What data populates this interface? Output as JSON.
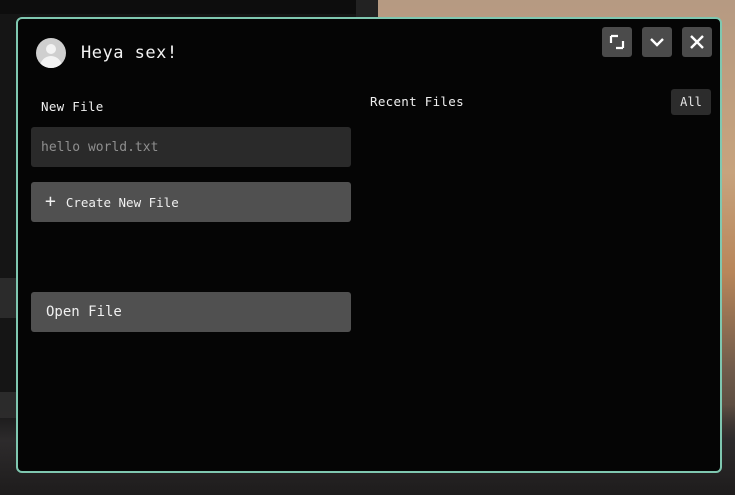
{
  "header": {
    "greeting": "Heya sex!"
  },
  "window_controls": {
    "maximize_icon": "expand-icon",
    "minimize_icon": "chevron-down-icon",
    "close_icon": "close-icon"
  },
  "new_file": {
    "label": "New File",
    "input_placeholder": "hello world.txt",
    "input_value": "",
    "create_button_label": "Create New File",
    "create_button_icon": "plus-icon"
  },
  "open_file": {
    "button_label": "Open File"
  },
  "recent_files": {
    "label": "Recent Files",
    "filter_label": "All",
    "items": []
  },
  "colors": {
    "window_border": "#7fc7b0",
    "window_bg": "#050505",
    "button_bg": "#505050",
    "input_bg": "#2a2a2a"
  }
}
